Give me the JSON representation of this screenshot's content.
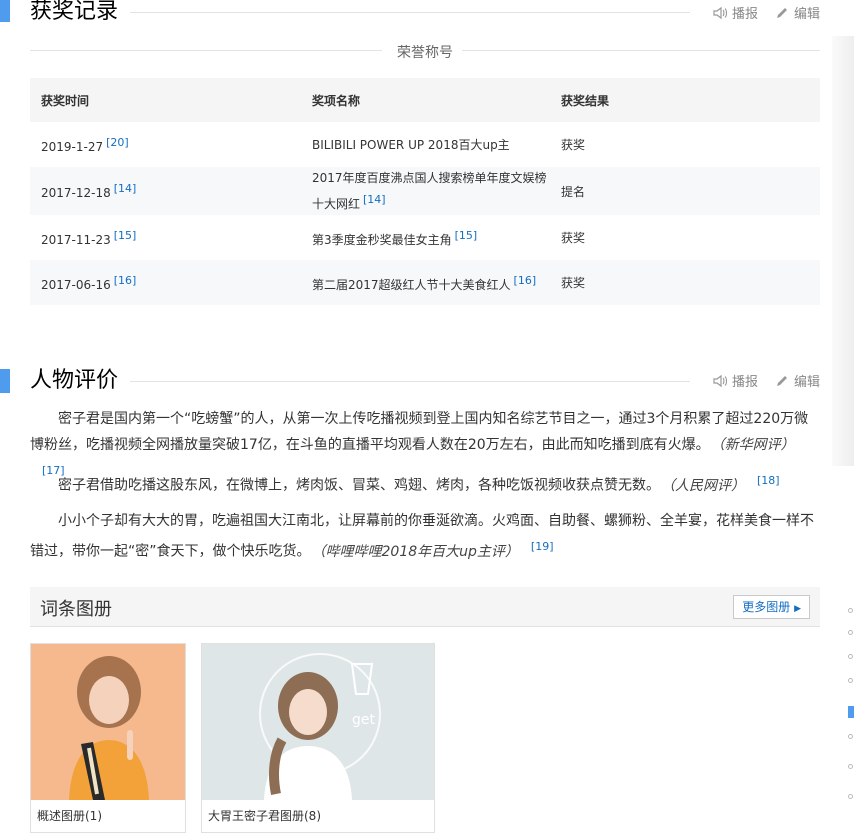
{
  "awards": {
    "title": "获奖记录",
    "tools": {
      "play": "播报",
      "edit": "编辑"
    },
    "honor_label": "荣誉称号",
    "columns": [
      "获奖时间",
      "奖项名称",
      "获奖结果"
    ],
    "rows": [
      {
        "date": "2019-1-27",
        "date_ref": "[20]",
        "name": "BILIBILI POWER UP 2018百大up主",
        "name_ref": "",
        "result": "获奖"
      },
      {
        "date": "2017-12-18",
        "date_ref": "[14]",
        "name": "2017年度百度沸点国人搜索榜单年度文娱榜十大网红",
        "name_ref": "[14]",
        "result": "提名"
      },
      {
        "date": "2017-11-23",
        "date_ref": "[15]",
        "name": "第3季度金秒奖最佳女主角",
        "name_ref": "[15]",
        "result": "获奖"
      },
      {
        "date": "2017-06-16",
        "date_ref": "[16]",
        "name": "第二届2017超级红人节十大美食红人",
        "name_ref": "[16]",
        "result": "获奖"
      }
    ]
  },
  "evaluation": {
    "title": "人物评价",
    "tools": {
      "play": "播报",
      "edit": "编辑"
    },
    "paragraphs": [
      {
        "text": "密子君是国内第一个“吃螃蟹”的人，从第一次上传吃播视频到登上国内知名综艺节目之一，通过3个月积累了超过220万微博粉丝，吃播视频全网播放量突破17亿，在斗鱼的直播平均观看人数在20万左右，由此而知吃播到底有火爆。",
        "source": "（新华网评）",
        "ref": "[17]"
      },
      {
        "text": "密子君借助吃播这股东风，在微博上，烤肉饭、冒菜、鸡翅、烤肉，各种吃饭视频收获点赞无数。",
        "source": "（人民网评）",
        "ref": "[18]"
      },
      {
        "text": "小小个子却有大大的胃，吃遍祖国大江南北，让屏幕前的你垂涎欲滴。火鸡面、自助餐、螺狮粉、全羊宴，花样美食一样不错过，带你一起“密”食天下，做个快乐吃货。",
        "source": "（哔哩哔哩2018年百大up主评）",
        "ref": "[19]"
      }
    ]
  },
  "album": {
    "title": "词条图册",
    "more_label": "更多图册",
    "cards": [
      {
        "caption": "概述图册(1)"
      },
      {
        "caption": "大胃王密子君图册(8)"
      }
    ]
  },
  "colors": {
    "accent": "#4f9cee",
    "link": "#136ec2"
  }
}
